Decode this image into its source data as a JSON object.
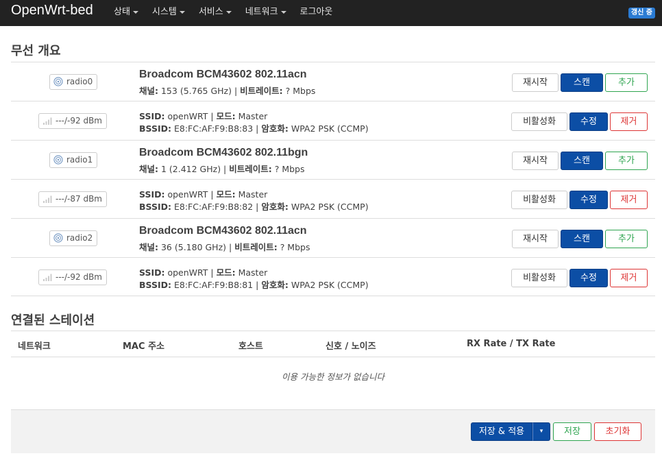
{
  "header": {
    "brand": "OpenWrt-bed",
    "menu": [
      {
        "label": "상태",
        "dropdown": true
      },
      {
        "label": "시스템",
        "dropdown": true
      },
      {
        "label": "서비스",
        "dropdown": true
      },
      {
        "label": "네트워크",
        "dropdown": true
      },
      {
        "label": "로그아웃",
        "dropdown": false
      }
    ],
    "badge": "갱신 중"
  },
  "wireless": {
    "title": "무선 개요",
    "radios": [
      {
        "name": "radio0",
        "device": "Broadcom BCM43602 802.11acn",
        "channel_label": "채널:",
        "channel": "153 (5.765 GHz)",
        "bitrate_label": "비트레이트:",
        "bitrate": "? Mbps",
        "btn_restart": "재시작",
        "btn_scan": "스캔",
        "btn_add": "추가",
        "network": {
          "signal": "---/-92 dBm",
          "ssid_label": "SSID:",
          "ssid": "openWRT",
          "mode_label": "모드:",
          "mode": "Master",
          "bssid_label": "BSSID:",
          "bssid": "E8:FC:AF:F9:B8:83",
          "enc_label": "암호화:",
          "enc": "WPA2 PSK (CCMP)",
          "btn_disable": "비활성화",
          "btn_edit": "수정",
          "btn_remove": "제거"
        }
      },
      {
        "name": "radio1",
        "device": "Broadcom BCM43602 802.11bgn",
        "channel_label": "채널:",
        "channel": "1 (2.412 GHz)",
        "bitrate_label": "비트레이트:",
        "bitrate": "? Mbps",
        "btn_restart": "재시작",
        "btn_scan": "스캔",
        "btn_add": "추가",
        "network": {
          "signal": "---/-87 dBm",
          "ssid_label": "SSID:",
          "ssid": "openWRT",
          "mode_label": "모드:",
          "mode": "Master",
          "bssid_label": "BSSID:",
          "bssid": "E8:FC:AF:F9:B8:82",
          "enc_label": "암호화:",
          "enc": "WPA2 PSK (CCMP)",
          "btn_disable": "비활성화",
          "btn_edit": "수정",
          "btn_remove": "제거"
        }
      },
      {
        "name": "radio2",
        "device": "Broadcom BCM43602 802.11acn",
        "channel_label": "채널:",
        "channel": "36 (5.180 GHz)",
        "bitrate_label": "비트레이트:",
        "bitrate": "? Mbps",
        "btn_restart": "재시작",
        "btn_scan": "스캔",
        "btn_add": "추가",
        "network": {
          "signal": "---/-92 dBm",
          "ssid_label": "SSID:",
          "ssid": "openWRT",
          "mode_label": "모드:",
          "mode": "Master",
          "bssid_label": "BSSID:",
          "bssid": "E8:FC:AF:F9:B8:81",
          "enc_label": "암호화:",
          "enc": "WPA2 PSK (CCMP)",
          "btn_disable": "비활성화",
          "btn_edit": "수정",
          "btn_remove": "제거"
        }
      }
    ]
  },
  "assoc": {
    "title": "연결된 스테이션",
    "columns": [
      "네트워크",
      "MAC 주소",
      "호스트",
      "신호 / 노이즈",
      "RX Rate / TX Rate"
    ],
    "empty": "이용 가능한 정보가 없습니다"
  },
  "footer": {
    "save_apply": "저장 & 적용",
    "dropdown_caret": "▾",
    "save": "저장",
    "reset": "초기화"
  },
  "colors": {
    "topbar": "#222222",
    "primary": "#0c4ea5",
    "positive": "#2ea44f",
    "negative": "#dd3333",
    "badge": "#2a7bd3"
  }
}
